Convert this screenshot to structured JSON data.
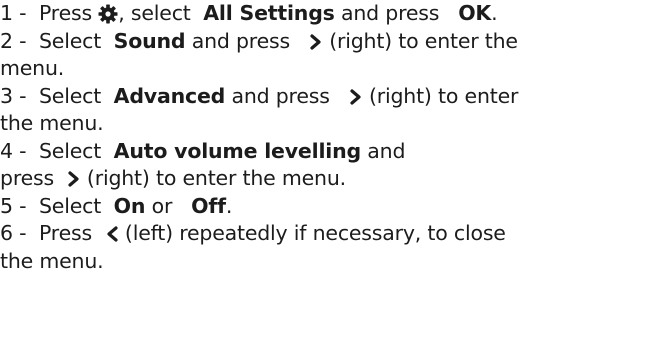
{
  "steps": [
    {
      "lines": [
        {
          "parts": [
            {
              "t": "text",
              "v": "1 -  Press "
            },
            {
              "t": "icon",
              "v": "gear-icon"
            },
            {
              "t": "text",
              "v": ", select  "
            },
            {
              "t": "bold",
              "v": "All Settings"
            },
            {
              "t": "text",
              "v": " and press   "
            },
            {
              "t": "bold",
              "v": "OK"
            },
            {
              "t": "text",
              "v": "."
            }
          ]
        }
      ]
    },
    {
      "lines": [
        {
          "parts": [
            {
              "t": "text",
              "v": "2 -  Select  "
            },
            {
              "t": "bold",
              "v": "Sound"
            },
            {
              "t": "text",
              "v": " and press   "
            },
            {
              "t": "icon",
              "v": "chevron-right-icon"
            },
            {
              "t": "text",
              "v": " (right) to enter the"
            }
          ]
        },
        {
          "parts": [
            {
              "t": "text",
              "v": "menu."
            }
          ]
        }
      ]
    },
    {
      "lines": [
        {
          "parts": [
            {
              "t": "text",
              "v": "3 -  Select  "
            },
            {
              "t": "bold",
              "v": "Advanced"
            },
            {
              "t": "text",
              "v": " and press   "
            },
            {
              "t": "icon",
              "v": "chevron-right-icon"
            },
            {
              "t": "text",
              "v": " (right) to enter"
            }
          ]
        },
        {
          "parts": [
            {
              "t": "text",
              "v": "the menu."
            }
          ]
        }
      ]
    },
    {
      "lines": [
        {
          "parts": [
            {
              "t": "text",
              "v": "4 -  Select  "
            },
            {
              "t": "bold",
              "v": "Auto volume levelling"
            },
            {
              "t": "text",
              "v": " and"
            }
          ]
        },
        {
          "parts": [
            {
              "t": "text",
              "v": "press  "
            },
            {
              "t": "icon",
              "v": "chevron-right-icon"
            },
            {
              "t": "text",
              "v": " (right) to enter the menu."
            }
          ]
        }
      ]
    },
    {
      "lines": [
        {
          "parts": [
            {
              "t": "text",
              "v": "5 -  Select  "
            },
            {
              "t": "bold",
              "v": "On"
            },
            {
              "t": "text",
              "v": " or   "
            },
            {
              "t": "bold",
              "v": "Off"
            },
            {
              "t": "text",
              "v": "."
            }
          ]
        }
      ]
    },
    {
      "lines": [
        {
          "parts": [
            {
              "t": "text",
              "v": "6 -  Press  "
            },
            {
              "t": "icon",
              "v": "chevron-left-icon"
            },
            {
              "t": "text",
              "v": " (left) repeatedly if necessary, to close"
            }
          ]
        },
        {
          "parts": [
            {
              "t": "text",
              "v": "the menu."
            }
          ]
        }
      ]
    }
  ],
  "colors": {
    "text": "#1c1c1c",
    "background": "#ffffff"
  }
}
